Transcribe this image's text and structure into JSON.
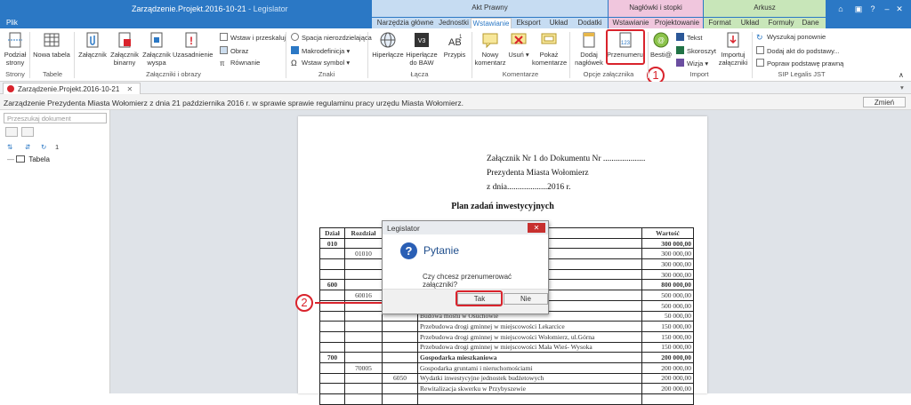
{
  "app": {
    "title": "Zarządzenie.Projekt.2016-10-21",
    "app_name": " - Legislator",
    "accent": "#2b78c5"
  },
  "context_groups": [
    {
      "label": "Akt Prawny",
      "color": "#c6dcf2"
    },
    {
      "label": "Nagłówki i stopki",
      "color": "#f0c6dd"
    },
    {
      "label": "Arkusz",
      "color": "#c8e6b9"
    }
  ],
  "tabs": {
    "plik": "Plik",
    "items": [
      "Narzędzia główne",
      "Jednostki",
      "Wstawianie",
      "Eksport",
      "Układ",
      "Dodatki",
      "Wstawianie",
      "Projektowanie",
      "Format",
      "Układ",
      "Formuły",
      "Dane"
    ],
    "active_index": 2
  },
  "ribbon": {
    "podzial_strony": "Podział strony",
    "nowa_tabela": "Nowa tabela",
    "zalacznik": "Załącznik",
    "zalacznik_binarny": "Załącznik binarny",
    "zalacznik_wyspa": "Załącznik wyspa",
    "uzasadnienie": "Uzasadnienie",
    "wstaw_przeskaluj": "Wstaw i przeskaluj",
    "obraz": "Obraz",
    "rownanie": "Równanie",
    "spacja": "Spacja nierozdzielająca",
    "makrodefinicja": "Makrodefinicja",
    "wstaw_symbol": "Wstaw symbol",
    "hiperlacze": "Hiperłącze",
    "hiperlacze_baw": "Hiperłącze do BAW",
    "przypis": "Przypis",
    "nowy_komentarz": "Nowy komentarz",
    "usun": "Usuń",
    "pokaz_komentarze": "Pokaż komentarze",
    "dodaj_naglowek": "Dodaj nagłówek",
    "przenumeruj": "Przenumeruj",
    "besti": "Besti@",
    "tekst": "Tekst",
    "skoroszyt": "Skoroszyt",
    "wizja": "Wizja",
    "importuj_zalaczniki": "Importuj załączniki",
    "wyszukaj_ponownie": "Wyszukaj ponownie",
    "dodaj_akt": "Dodaj akt do podstawy...",
    "popraw_podstawe": "Popraw podstawę prawną",
    "groups": {
      "strony": "Strony",
      "tabele": "Tabele",
      "zalaczniki_obrazy": "Załączniki i obrazy",
      "znaki": "Znaki",
      "lacza": "Łącza",
      "komentarze": "Komentarze",
      "opcje_zalacznika": "Opcje załącznika",
      "import": "Import",
      "sip": "SIP Legalis JST"
    }
  },
  "callouts": {
    "one": "1",
    "two": "2",
    "color": "#d9232c"
  },
  "doc_tab": "Zarządzenie.Projekt.2016-10-21",
  "info_text": "Zarządzenie Prezydenta Miasta Wołomierz z dnia 21 października 2016 r. w sprawie sprawie regulaminu pracy urzędu Miasta Wołomierz.",
  "zmien_label": "Zmień",
  "sidebar": {
    "search_placeholder": "Przeszukaj dokument",
    "counter": "1",
    "tree_item": "Tabela"
  },
  "document": {
    "header_lines": [
      "Załącznik Nr 1 do Dokumentu Nr ....................",
      "Prezydenta Miasta Wołomierz",
      "z dnia...................2016 r."
    ],
    "title": "Plan zadań inwestycyjnych",
    "columns": [
      "Dział",
      "Rozdział",
      "",
      "",
      "Wartość"
    ],
    "rows": [
      {
        "dzial": "010",
        "rozdzial": "",
        "par": "",
        "name": "",
        "value": "300 000,00",
        "bold": true
      },
      {
        "dzial": "",
        "rozdzial": "01010",
        "par": "",
        "name": "",
        "value": "300 000,00",
        "bold": false
      },
      {
        "dzial": "",
        "rozdzial": "",
        "par": "",
        "name": "",
        "value": "300 000,00",
        "bold": false
      },
      {
        "dzial": "",
        "rozdzial": "",
        "par": "",
        "name": "acja uzdatniania wody",
        "value": "300 000,00",
        "bold": false
      },
      {
        "dzial": "600",
        "rozdzial": "",
        "par": "",
        "name": "",
        "value": "800 000,00",
        "bold": true
      },
      {
        "dzial": "",
        "rozdzial": "60016",
        "par": "",
        "name": "",
        "value": "500 000,00",
        "bold": false
      },
      {
        "dzial": "",
        "rozdzial": "",
        "par": "",
        "name": "",
        "value": "500 000,00",
        "bold": false
      },
      {
        "dzial": "",
        "rozdzial": "",
        "par": "",
        "name": "Budowa mostu w Osuchowie",
        "value": "50 000,00",
        "bold": false
      },
      {
        "dzial": "",
        "rozdzial": "",
        "par": "",
        "name": "Przebudowa drogi gminnej w miejscowości Lekarcice",
        "value": "150 000,00",
        "bold": false
      },
      {
        "dzial": "",
        "rozdzial": "",
        "par": "",
        "name": "Przebudowa drogi gminnej w miejscowości Wołomierz, ul.Górna",
        "value": "150 000,00",
        "bold": false
      },
      {
        "dzial": "",
        "rozdzial": "",
        "par": "",
        "name": "Przebudowa drogi gminnej w miejscowości Mała Wieś- Wysoka",
        "value": "150 000,00",
        "bold": false
      },
      {
        "dzial": "700",
        "rozdzial": "",
        "par": "",
        "name": "Gospodarka mieszkaniowa",
        "value": "200 000,00",
        "bold": true
      },
      {
        "dzial": "",
        "rozdzial": "70005",
        "par": "",
        "name": "Gospodarka gruntami i nieruchomościami",
        "value": "200 000,00",
        "bold": false
      },
      {
        "dzial": "",
        "rozdzial": "",
        "par": "6050",
        "name": "Wydatki inwestycyjne jednostek budżetowych",
        "value": "200 000,00",
        "bold": false
      },
      {
        "dzial": "",
        "rozdzial": "",
        "par": "",
        "name": "Rewitalizacja skwerku w Przybyszewie",
        "value": "200 000,00",
        "bold": false
      },
      {
        "dzial": "",
        "rozdzial": "",
        "par": "",
        "name": "",
        "value": "",
        "bold": false
      }
    ]
  },
  "dialog": {
    "title": "Legislator",
    "heading": "Pytanie",
    "message": "Czy chcesz przenumerować załączniki?",
    "yes": "Tak",
    "no": "Nie"
  }
}
